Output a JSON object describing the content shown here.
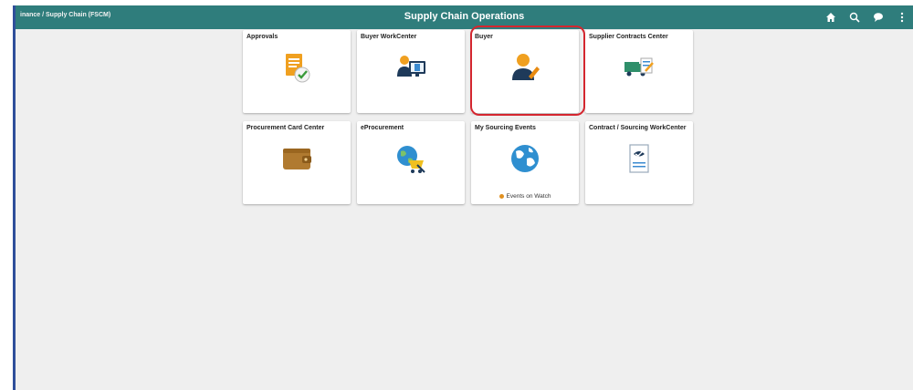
{
  "topbar": {
    "breadcrumb": "inance / Supply Chain (FSCM)",
    "title": "Supply Chain Operations",
    "icons": [
      "home-icon",
      "search-icon",
      "chat-icon",
      "more-icon"
    ],
    "color": "#2f7d7c"
  },
  "tiles": [
    {
      "label": "Approvals",
      "icon": "approvals-icon"
    },
    {
      "label": "Buyer WorkCenter",
      "icon": "buyer-workcenter-icon"
    },
    {
      "label": "Buyer",
      "icon": "buyer-icon"
    },
    {
      "label": "Supplier Contracts Center",
      "icon": "supplier-contracts-icon"
    },
    {
      "label": "Procurement Card Center",
      "icon": "wallet-icon"
    },
    {
      "label": "eProcurement",
      "icon": "eprocurement-icon"
    },
    {
      "label": "My Sourcing Events",
      "icon": "globe-icon",
      "sub": "Events on Watch"
    },
    {
      "label": "Contract / Sourcing WorkCenter",
      "icon": "contract-sourcing-icon"
    }
  ],
  "highlight_color": "#d4262f"
}
